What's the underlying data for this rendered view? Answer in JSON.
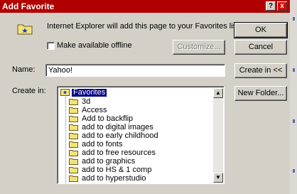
{
  "window": {
    "title": "Add Favorite",
    "help_label": "?",
    "close_label": "x"
  },
  "message": "Internet Explorer will add this page to your Favorites list.",
  "offline_checkbox": {
    "label": "Make available offline",
    "checked": false
  },
  "buttons": {
    "ok": "OK",
    "cancel": "Cancel",
    "customize": "Customize...",
    "create_in": "Create in <<",
    "new_folder": "New Folder..."
  },
  "name_field": {
    "label": "Name:",
    "value": "Yahoo!"
  },
  "create_in_label": "Create in:",
  "tree": {
    "root": "Favorites",
    "folders": [
      "3d",
      "Access",
      "Add to backflip",
      "add to digital images",
      "add to early childhood",
      "add to fonts",
      "add to free resources",
      "add to graphics",
      "add to HS & 1 comp",
      "add to hyperstudio"
    ]
  },
  "colors": {
    "title_bar": "#b00000",
    "dialog_bg": "#d4d0c8",
    "selection": "#000080"
  }
}
